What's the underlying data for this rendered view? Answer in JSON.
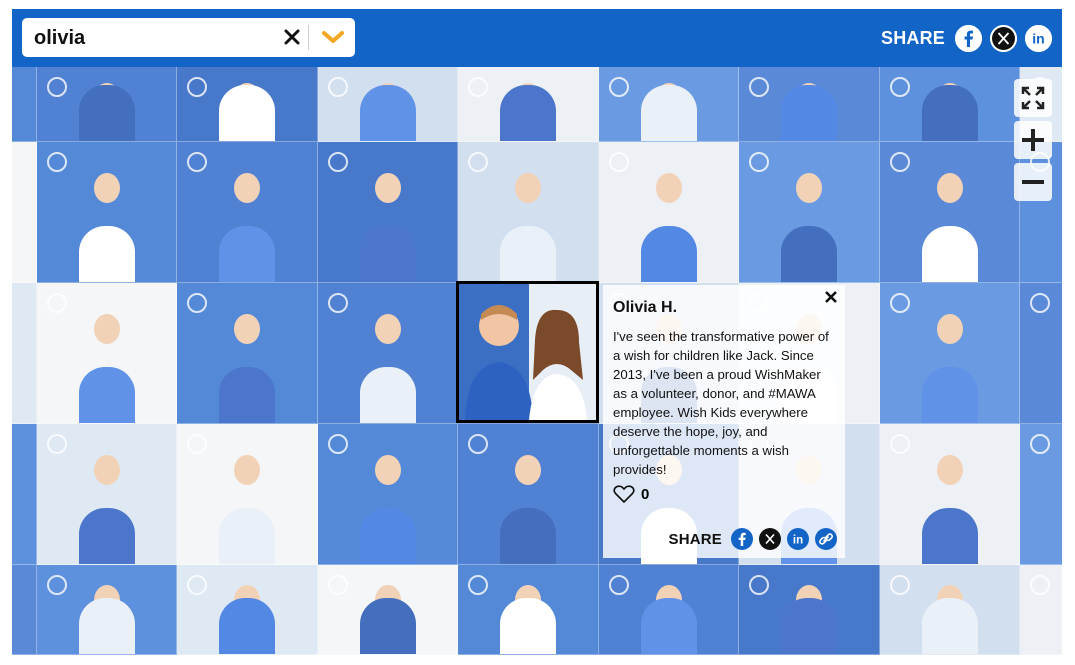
{
  "search": {
    "value": "olivia",
    "clear_icon": "close-icon",
    "dropdown_icon": "chevron-down-icon"
  },
  "share_bar": {
    "label": "SHARE",
    "icons": [
      "facebook-icon",
      "x-icon",
      "linkedin-icon"
    ]
  },
  "zoom": {
    "icons": [
      "fullscreen-icon",
      "plus-icon",
      "minus-icon"
    ]
  },
  "popup": {
    "name": "Olivia H.",
    "story": "I've seen the transformative power of a wish for children like Jack. Since 2013, I've been a proud WishMaker as a volunteer, donor, and #MAWA employee. Wish Kids everywhere deserve the hope, joy, and unforgettable moments a wish provides!",
    "likes": "0",
    "share_label": "SHARE",
    "share_icons": [
      "facebook-icon",
      "x-icon",
      "linkedin-icon",
      "link-icon"
    ]
  },
  "colors": {
    "brand_blue": "#1264c7",
    "accent_orange": "#f5a623"
  }
}
